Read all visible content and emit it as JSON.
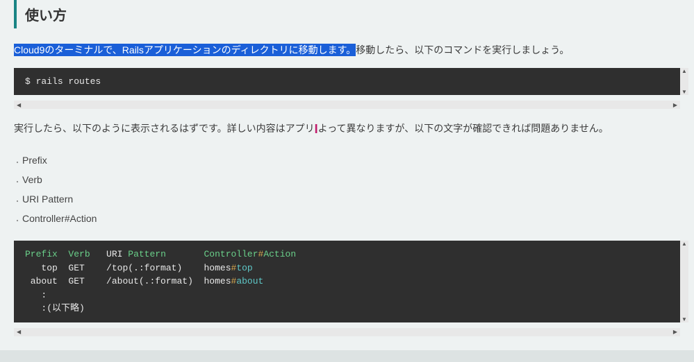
{
  "heading": "使い方",
  "intro": {
    "highlighted": "Cloud9のターミナルで、Railsアプリケーションのディレクトリに移動します。",
    "rest": "移動したら、以下のコマンドを実行しましょう。"
  },
  "cmd1": {
    "prompt": "$ ",
    "text": "rails routes"
  },
  "after_cmd": {
    "part1": "実行したら、以下のように表示されるはずです。詳しい内容はアプリ",
    "part2": "よって異なりますが、以下の文字が確認できれば問題ありません。"
  },
  "list": [
    "Prefix",
    "Verb",
    "URI Pattern",
    "Controller#Action"
  ],
  "routes": {
    "header": {
      "prefix": "Prefix",
      "verb": "Verb",
      "uri": "URI",
      "pattern": "Pattern",
      "ctrl": "Controller",
      "hash": "#",
      "action": "Action"
    },
    "rows": [
      {
        "prefix": "top",
        "verb": "GET",
        "uri": "/top(.:format)",
        "ctrl": "homes",
        "hash": "#",
        "action": "top"
      },
      {
        "prefix": "about",
        "verb": "GET",
        "uri": "/about(.:format)",
        "ctrl": "homes",
        "hash": "#",
        "action": "about"
      }
    ],
    "tail1": "   :",
    "tail2": "   :(以下略)"
  },
  "scroll": {
    "up": "▲",
    "down": "▼",
    "left": "◀",
    "right": "▶"
  }
}
